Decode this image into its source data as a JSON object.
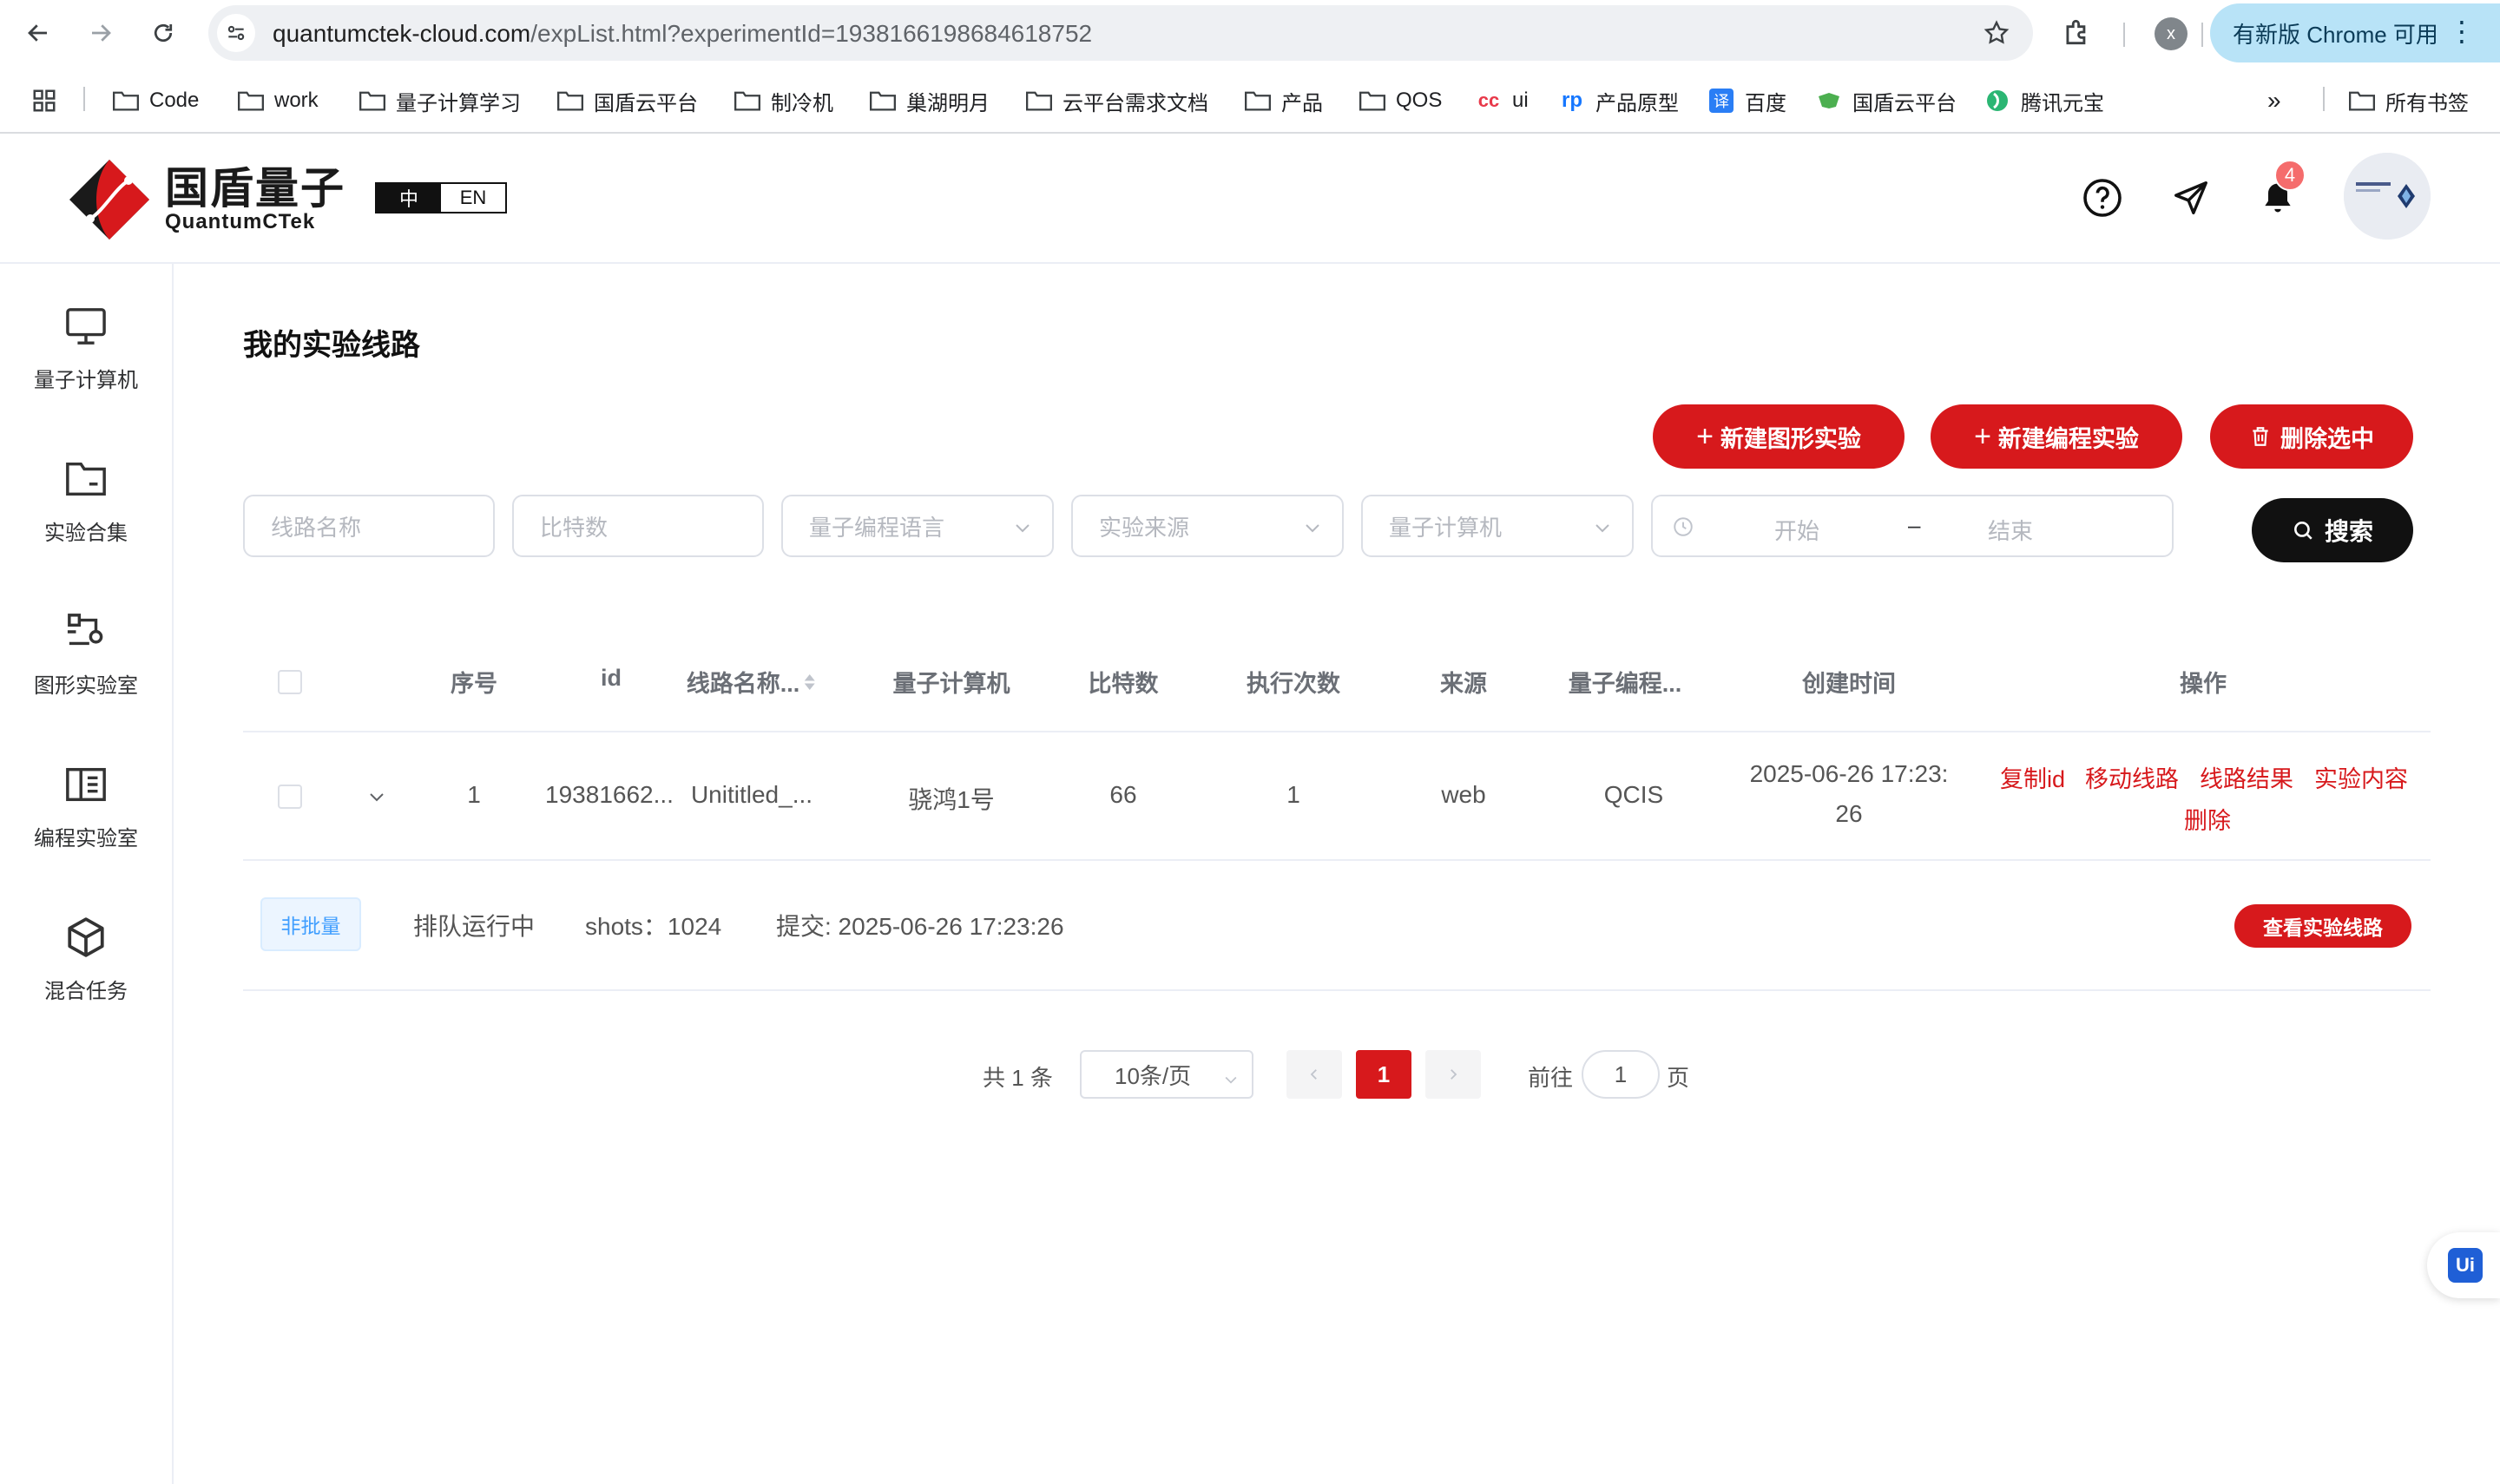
{
  "browser": {
    "url_host": "quantumctek-cloud.com",
    "url_path": "/expList.html?experimentId=1938166198684618752",
    "profile_initial": "x",
    "update_label": "有新版 Chrome 可用",
    "bookmarks": [
      "Code",
      "work",
      "量子计算学习",
      "国盾云平台",
      "制冷机",
      "巢湖明月",
      "云平台需求文档",
      "产品",
      "QOS",
      "ui",
      "产品原型",
      "百度",
      "国盾云平台",
      "腾讯元宝"
    ],
    "more": "»",
    "all_bookmarks": "所有书签"
  },
  "header": {
    "logo_cn": "国盾量子",
    "logo_en": "QuantumCTek",
    "lang_cn": "中",
    "lang_en": "EN",
    "notification_count": "4"
  },
  "sidebar": {
    "items": [
      {
        "label": "量子计算机",
        "icon": "monitor-icon"
      },
      {
        "label": "实验合集",
        "icon": "folder-icon"
      },
      {
        "label": "图形实验室",
        "icon": "circuit-icon"
      },
      {
        "label": "编程实验室",
        "icon": "code-panel-icon"
      },
      {
        "label": "混合任务",
        "icon": "cube-icon"
      }
    ]
  },
  "main": {
    "title": "我的实验线路",
    "buttons": {
      "new_graphic": "新建图形实验",
      "new_code": "新建编程实验",
      "delete_selected": "删除选中",
      "search": "搜索"
    },
    "filters": {
      "circuit_name": "线路名称",
      "qubits": "比特数",
      "language": "量子编程语言",
      "source": "实验来源",
      "computer": "量子计算机",
      "date_start": "开始",
      "date_sep": "–",
      "date_end": "结束"
    },
    "table": {
      "columns": [
        "序号",
        "id",
        "线路名称...",
        "量子计算机",
        "比特数",
        "执行次数",
        "来源",
        "量子编程...",
        "创建时间",
        "操作"
      ],
      "rows": [
        {
          "index": "1",
          "id": "19381662...",
          "name": "Unititled_...",
          "computer": "骁鸿1号",
          "qubits": "66",
          "runs": "1",
          "source": "web",
          "language": "QCIS",
          "created_line1": "2025-06-26 17:23:",
          "created_line2": "26",
          "actions": [
            "复制id",
            "移动线路",
            "线路结果",
            "实验内容",
            "删除"
          ]
        }
      ],
      "detail": {
        "tag": "非批量",
        "status": "排队运行中",
        "shots": "shots：1024",
        "submitted": "提交: 2025-06-26 17:23:26",
        "view_button": "查看实验线路"
      }
    },
    "pagination": {
      "total": "共 1 条",
      "page_size": "10条/页",
      "current_page": "1",
      "goto_label": "前往",
      "goto_value": "1",
      "page_unit": "页"
    }
  },
  "floating": {
    "label": "Ui"
  },
  "colors": {
    "accent": "#d7191c",
    "tag_blue": "#409eff"
  }
}
